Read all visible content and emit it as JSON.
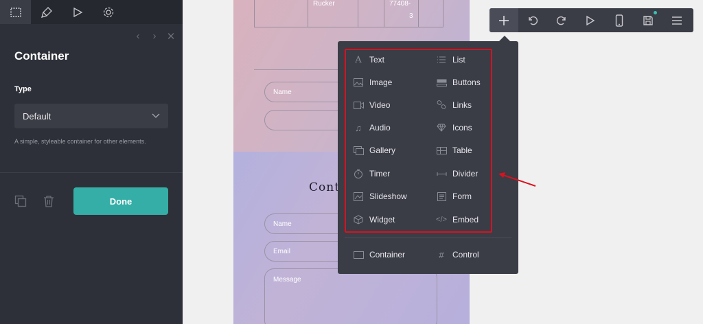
{
  "sidebar": {
    "tabs": [
      {
        "name": "select-icon"
      },
      {
        "name": "brush-icon"
      },
      {
        "name": "play-icon"
      },
      {
        "name": "gear-icon"
      }
    ],
    "title": "Container",
    "type_label": "Type",
    "type_value": "Default",
    "description": "A simple, styleable container for other elements.",
    "done_label": "Done"
  },
  "page": {
    "table_cells": [
      "Rucker",
      "77408-",
      "3"
    ],
    "form1": {
      "name_placeholder": "Name"
    },
    "contact_heading": "Conta",
    "form2": {
      "name_placeholder": "Name",
      "email_placeholder": "Email",
      "message_placeholder": "Message"
    }
  },
  "toolbar": {
    "buttons": [
      "add-icon",
      "undo-icon",
      "redo-icon",
      "preview-play-icon",
      "mobile-icon",
      "save-icon",
      "menu-icon"
    ],
    "accent": "#3bbfb5"
  },
  "elements_menu": {
    "left": [
      "Text",
      "Image",
      "Video",
      "Audio",
      "Gallery",
      "Timer",
      "Slideshow",
      "Widget"
    ],
    "right": [
      "List",
      "Buttons",
      "Links",
      "Icons",
      "Table",
      "Divider",
      "Form",
      "Embed"
    ],
    "bottom_left": "Container",
    "bottom_right": "Control"
  },
  "colors": {
    "sidebar_bg": "#2e3039",
    "done_button": "#34aea6",
    "highlight": "#d9121f"
  }
}
